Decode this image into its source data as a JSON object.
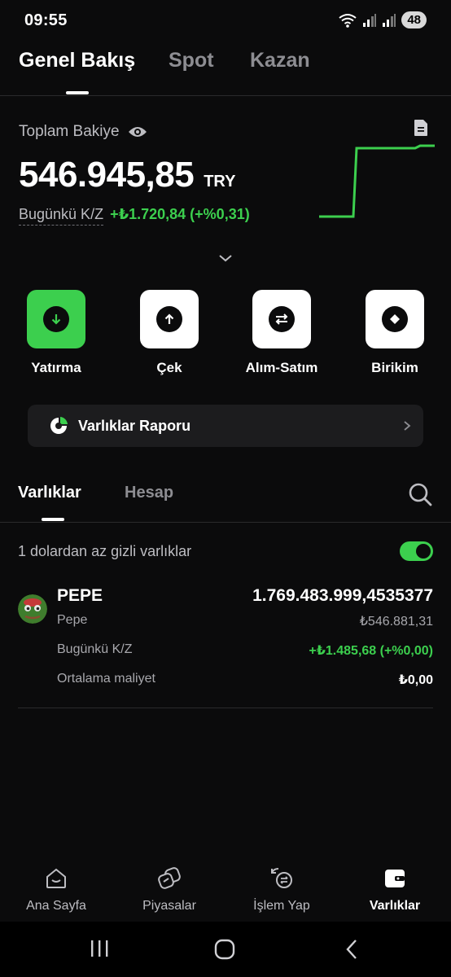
{
  "status_bar": {
    "time": "09:55",
    "battery": "48"
  },
  "top_tabs": [
    {
      "label": "Genel Bakış",
      "active": true
    },
    {
      "label": "Spot",
      "active": false
    },
    {
      "label": "Kazan",
      "active": false
    }
  ],
  "balance": {
    "label": "Toplam Bakiye",
    "amount": "546.945,85",
    "currency": "TRY",
    "pnl_label": "Bugünkü K/Z",
    "pnl_value": "+₺1.720,84 (+%0,31)"
  },
  "actions": [
    {
      "label": "Yatırma",
      "icon": "arrow-down-icon"
    },
    {
      "label": "Çek",
      "icon": "arrow-up-icon"
    },
    {
      "label": "Alım-Satım",
      "icon": "swap-icon"
    },
    {
      "label": "Birikim",
      "icon": "diamond-icon"
    }
  ],
  "report_banner": {
    "label": "Varlıklar Raporu"
  },
  "lower_tabs": [
    {
      "label": "Varlıklar",
      "active": true
    },
    {
      "label": "Hesap",
      "active": false
    }
  ],
  "hidden_assets": {
    "label": "1 dolardan az gizli varlıklar",
    "enabled": true
  },
  "assets": [
    {
      "symbol": "PEPE",
      "name": "Pepe",
      "amount": "1.769.483.999,4535377",
      "value": "₺546.881,31",
      "pnl_label": "Bugünkü K/Z",
      "pnl_value": "+₺1.485,68 (+%0,00)",
      "cost_label": "Ortalama maliyet",
      "cost_value": "₺0,00"
    }
  ],
  "bottom_nav": [
    {
      "label": "Ana Sayfa",
      "icon": "home-icon",
      "active": false
    },
    {
      "label": "Piyasalar",
      "icon": "markets-icon",
      "active": false
    },
    {
      "label": "İşlem Yap",
      "icon": "trade-icon",
      "active": false
    },
    {
      "label": "Varlıklar",
      "icon": "wallet-icon",
      "active": true
    }
  ],
  "colors": {
    "accent": "#3ccf4e",
    "background": "#0b0b0c",
    "card": "#1c1c1e"
  }
}
